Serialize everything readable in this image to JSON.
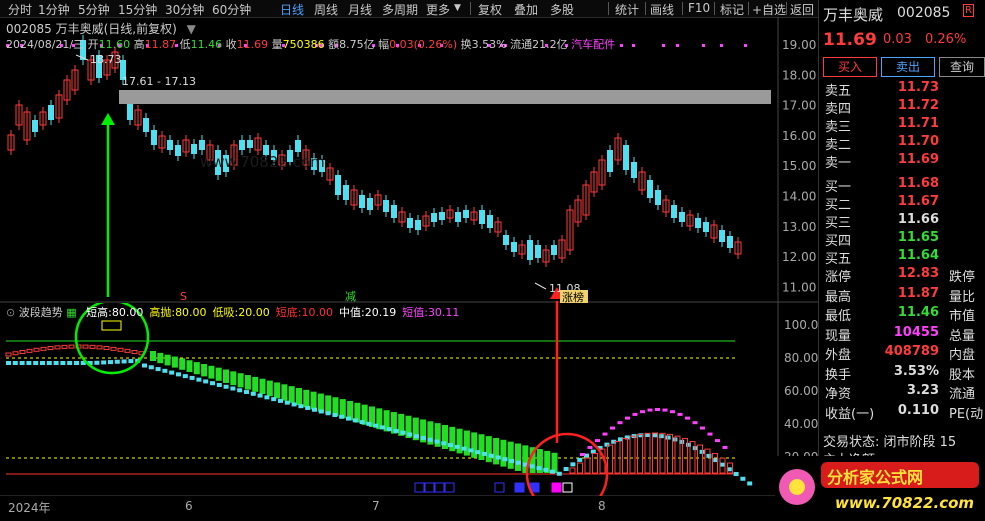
{
  "toolbar": {
    "periods": [
      "分时",
      "1分钟",
      "5分钟",
      "15分钟",
      "30分钟",
      "60分钟",
      "日线",
      "周线",
      "月线",
      "多周期",
      "更多"
    ],
    "active_period": "日线",
    "tools": [
      "复权",
      "叠加",
      "多股",
      "统计",
      "画线",
      "F10",
      "标记",
      "+自选",
      "返回"
    ]
  },
  "stock": {
    "code": "002085",
    "name": "万丰奥威",
    "title_line": "002085 万丰奥威(日线,前复权)",
    "date": "2024/08/21/三",
    "open_label": "开",
    "open": "11.60",
    "high_label": "高",
    "high": "11.87",
    "low_label": "低",
    "low": "11.46",
    "close_label": "收",
    "close": "11.69",
    "vol_label": "量",
    "volume": "750386",
    "amount_label": "额",
    "amount": "8.75亿",
    "change_label": "幅",
    "change": "0.03(0.26%)",
    "turnover_label": "换",
    "turnover": "3.53%",
    "float_label": "流通",
    "float": "21.2亿",
    "sector": "汽车配件"
  },
  "annotations": {
    "high_mark": "18.73",
    "low_mark": "11.08",
    "range_label": "17.61 - 17.13",
    "limit_up_tag": "涨榜",
    "sig_s": "S",
    "sig_reduce": "减"
  },
  "y_axis_main": [
    "19.00",
    "18.00",
    "17.00",
    "16.00",
    "15.00",
    "14.00",
    "13.00",
    "12.00",
    "11.00"
  ],
  "y_axis_ind": [
    "100.0",
    "80.00",
    "60.00",
    "40.00",
    "20.00"
  ],
  "x_axis": [
    "2024年",
    "6",
    "7",
    "8"
  ],
  "indicator": {
    "name": "波段趋势",
    "items": [
      {
        "label": "短高:",
        "value": "80.00",
        "color": "#ffffff"
      },
      {
        "label": "高抛:",
        "value": "80.00",
        "color": "#ffff00"
      },
      {
        "label": "低吸:",
        "value": "20.00",
        "color": "#ffff00"
      },
      {
        "label": "短底:",
        "value": "10.00",
        "color": "#ff3030"
      },
      {
        "label": "中值:",
        "value": "20.19",
        "color": "#ffffff"
      },
      {
        "label": "短值:",
        "value": "30.11",
        "color": "#ff40ff"
      }
    ]
  },
  "panel": {
    "price": "11.69",
    "chg": "0.03",
    "pct": "0.26%",
    "r_mark": "R",
    "buttons": [
      "买入",
      "卖出",
      "查询"
    ],
    "asks": [
      {
        "label": "卖五",
        "price": "11.73"
      },
      {
        "label": "卖四",
        "price": "11.72"
      },
      {
        "label": "卖三",
        "price": "11.71"
      },
      {
        "label": "卖二",
        "price": "11.70"
      },
      {
        "label": "卖一",
        "price": "11.69"
      }
    ],
    "bids": [
      {
        "label": "买一",
        "price": "11.68",
        "color": "#ff3b3b"
      },
      {
        "label": "买二",
        "price": "11.67",
        "color": "#ff3b3b"
      },
      {
        "label": "买三",
        "price": "11.66",
        "color": "#dddddd"
      },
      {
        "label": "买四",
        "price": "11.65",
        "color": "#33dd33"
      },
      {
        "label": "买五",
        "price": "11.64",
        "color": "#33dd33"
      }
    ],
    "stats": [
      {
        "l": "涨停",
        "v": "12.83",
        "r": "跌停",
        "c": "#ff3b3b"
      },
      {
        "l": "最高",
        "v": "11.87",
        "r": "量比",
        "c": "#ff3b3b"
      },
      {
        "l": "最低",
        "v": "11.46",
        "r": "市值",
        "c": "#33dd33"
      },
      {
        "l": "现量",
        "v": "10455",
        "r": "总量",
        "c": "#ff40ff"
      },
      {
        "l": "外盘",
        "v": "408789",
        "r": "内盘",
        "c": "#ff3b3b"
      },
      {
        "l": "换手",
        "v": "3.53%",
        "r": "股本",
        "c": "#dddddd"
      },
      {
        "l": "净资",
        "v": "3.23",
        "r": "流通",
        "c": "#dddddd"
      },
      {
        "l": "收益(一)",
        "v": "0.110",
        "r": "PE(动",
        "c": "#dddddd"
      }
    ],
    "trade_state": "交易状态: 闭市阶段 15",
    "main_net": "主力净额"
  },
  "watermark": {
    "text": "分析家公式网",
    "url": "www.70822.com"
  },
  "colors": {
    "up": "#ff3b3b",
    "down": "#4ee0f0",
    "green_bar": "#22dd22"
  }
}
